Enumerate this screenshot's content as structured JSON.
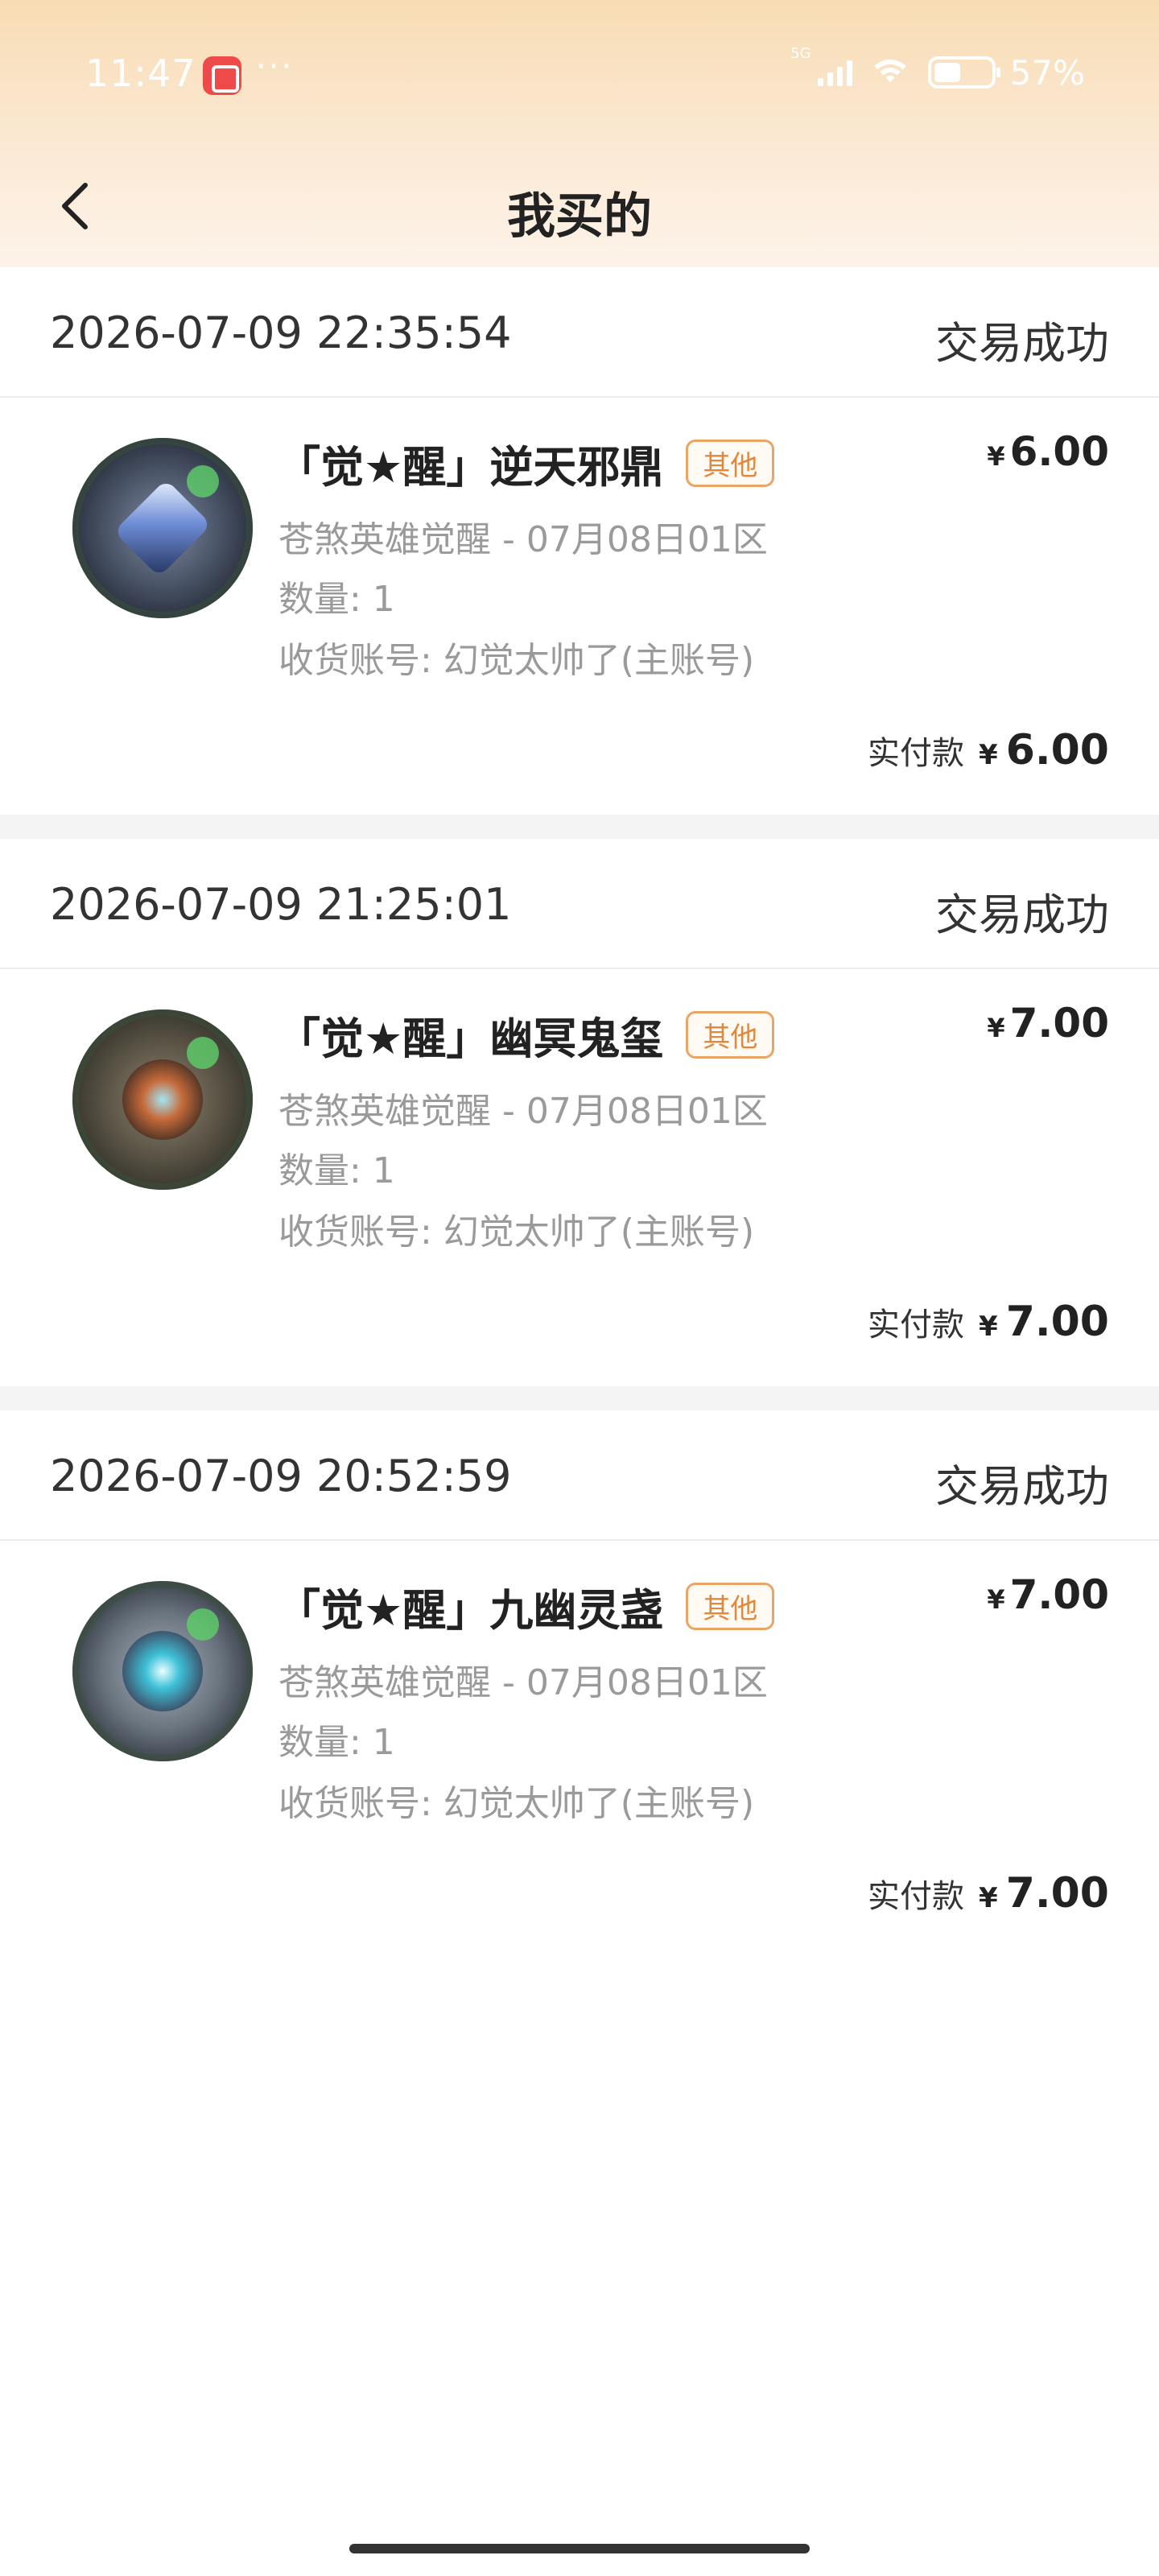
{
  "status_bar": {
    "time": "11:47",
    "network": "5G",
    "battery": "57%"
  },
  "nav": {
    "title": "我买的"
  },
  "orders": [
    {
      "time": "2026-07-09 22:35:54",
      "status": "交易成功",
      "item_title": "「觉★醒」逆天邪鼎",
      "tag": "其他",
      "server": "苍煞英雄觉醒 - 07月08日01区",
      "quantity": "数量: 1",
      "account": "收货账号: 幻觉太帅了(主账号)",
      "currency": "¥",
      "price": "6.00",
      "paid_label": "实付款",
      "paid_amount": "6.00"
    },
    {
      "time": "2026-07-09 21:25:01",
      "status": "交易成功",
      "item_title": "「觉★醒」幽冥鬼玺",
      "tag": "其他",
      "server": "苍煞英雄觉醒 - 07月08日01区",
      "quantity": "数量: 1",
      "account": "收货账号: 幻觉太帅了(主账号)",
      "currency": "¥",
      "price": "7.00",
      "paid_label": "实付款",
      "paid_amount": "7.00"
    },
    {
      "time": "2026-07-09 20:52:59",
      "status": "交易成功",
      "item_title": "「觉★醒」九幽灵盏",
      "tag": "其他",
      "server": "苍煞英雄觉醒 - 07月08日01区",
      "quantity": "数量: 1",
      "account": "收货账号: 幻觉太帅了(主账号)",
      "currency": "¥",
      "price": "7.00",
      "paid_label": "实付款",
      "paid_amount": "7.00"
    }
  ],
  "icons": {
    "back": "chevron-left-icon",
    "app": "kuaishou-app-icon",
    "signal": "signal-icon",
    "wifi": "wifi-icon",
    "battery": "battery-icon"
  },
  "colors": {
    "header_gradient_top": "#f8dcb4",
    "tag_orange": "#e2883a",
    "secondary_text": "#9a9a9a"
  }
}
